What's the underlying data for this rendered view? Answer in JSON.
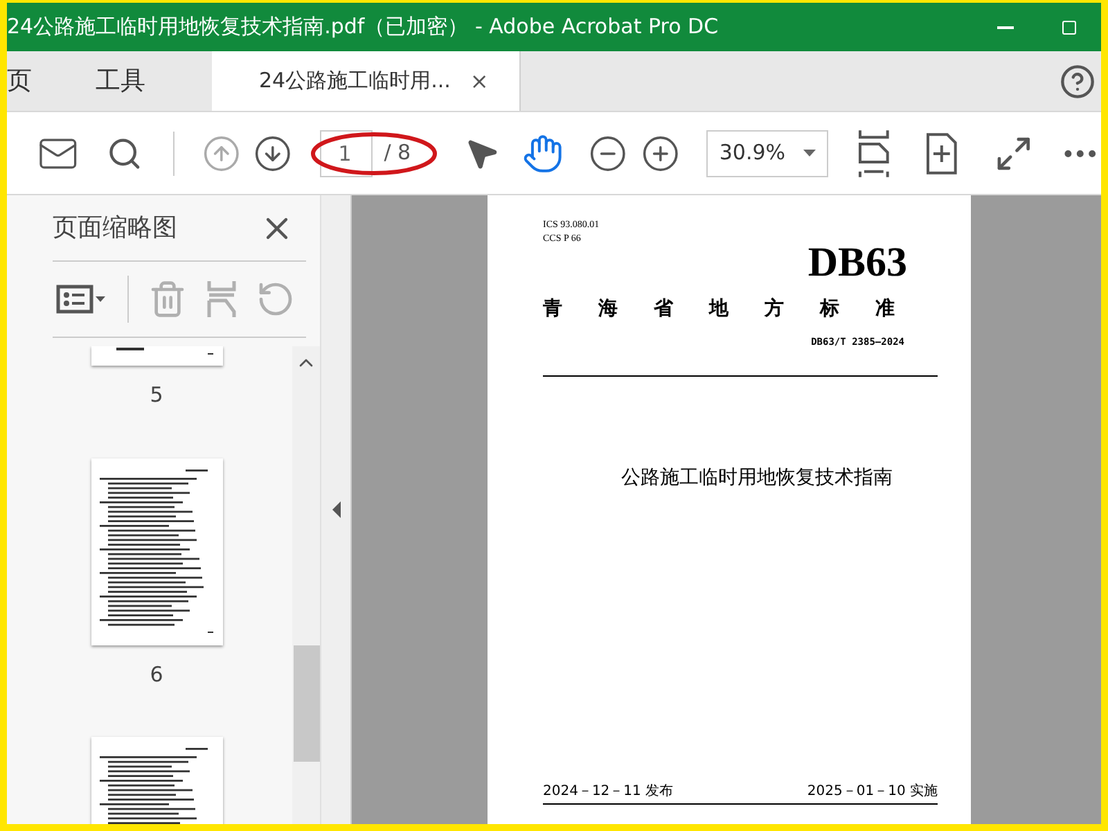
{
  "window": {
    "title": "24公路施工临时用地恢复技术指南.pdf（已加密） - Adobe Acrobat Pro DC"
  },
  "tabs": [
    {
      "label": "页",
      "selected": false
    },
    {
      "label": "工具",
      "selected": false
    },
    {
      "label": "24公路施工临时用...",
      "selected": true,
      "close": "×"
    }
  ],
  "toolbar": {
    "previous_page_disabled": true,
    "next_page_disabled": false,
    "page_number": "1",
    "page_total": "/ 8",
    "zoom": "30.9%",
    "hand_tool_selected": true
  },
  "sidebar": {
    "title": "页面缩略图",
    "thumbnails": [
      {
        "label": "5",
        "partial": true
      },
      {
        "label": "6",
        "partial": false
      },
      {
        "partial": false
      }
    ]
  },
  "document": {
    "ics": "ICS  93.080.01",
    "ccs": "CCS  P 66",
    "code": "DB63",
    "category": "青海省地方标准",
    "number": "DB63/T 2385—2024",
    "title": "公路施工临时用地恢复技术指南",
    "issued": "2024－12－11 发布",
    "effective": "2025－01－10 实施"
  }
}
